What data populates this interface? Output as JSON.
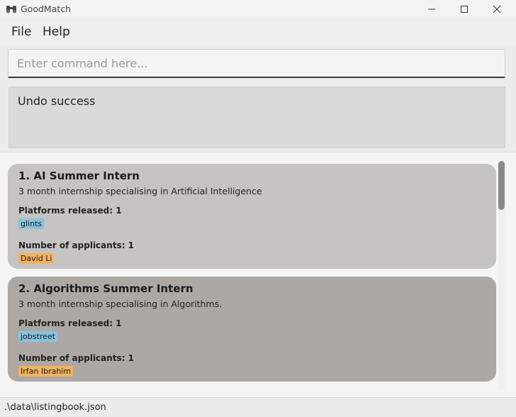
{
  "window": {
    "title": "GoodMatch",
    "icons": {
      "app": "binoculars-icon",
      "minimize": "minimize-icon",
      "maximize": "maximize-icon",
      "close": "close-icon"
    }
  },
  "menu": {
    "file": "File",
    "help": "Help"
  },
  "command": {
    "placeholder": "Enter command here...",
    "value": ""
  },
  "result": {
    "text": "Undo success"
  },
  "listings": [
    {
      "title": "1.  AI Summer Intern",
      "description": "3 month internship specialising in Artificial Intelligence",
      "platforms_label": "Platforms released: 1",
      "platforms": [
        "glints"
      ],
      "applicants_label": "Number of applicants: 1",
      "applicants": [
        "David Li"
      ]
    },
    {
      "title": "2.  Algorithms Summer Intern",
      "description": "3 month internship specialising in Algorithms.",
      "platforms_label": "Platforms released: 1",
      "platforms": [
        "jobstreet"
      ],
      "applicants_label": "Number of applicants: 1",
      "applicants": [
        "Irfan Ibrahim"
      ]
    }
  ],
  "status": {
    "path": ".\\data\\listingbook.json"
  },
  "colors": {
    "card_1": "#c6c4c2",
    "card_2": "#aea8a5",
    "platform_tag": "#86c3e0",
    "applicant_tag": "#f2b262"
  }
}
